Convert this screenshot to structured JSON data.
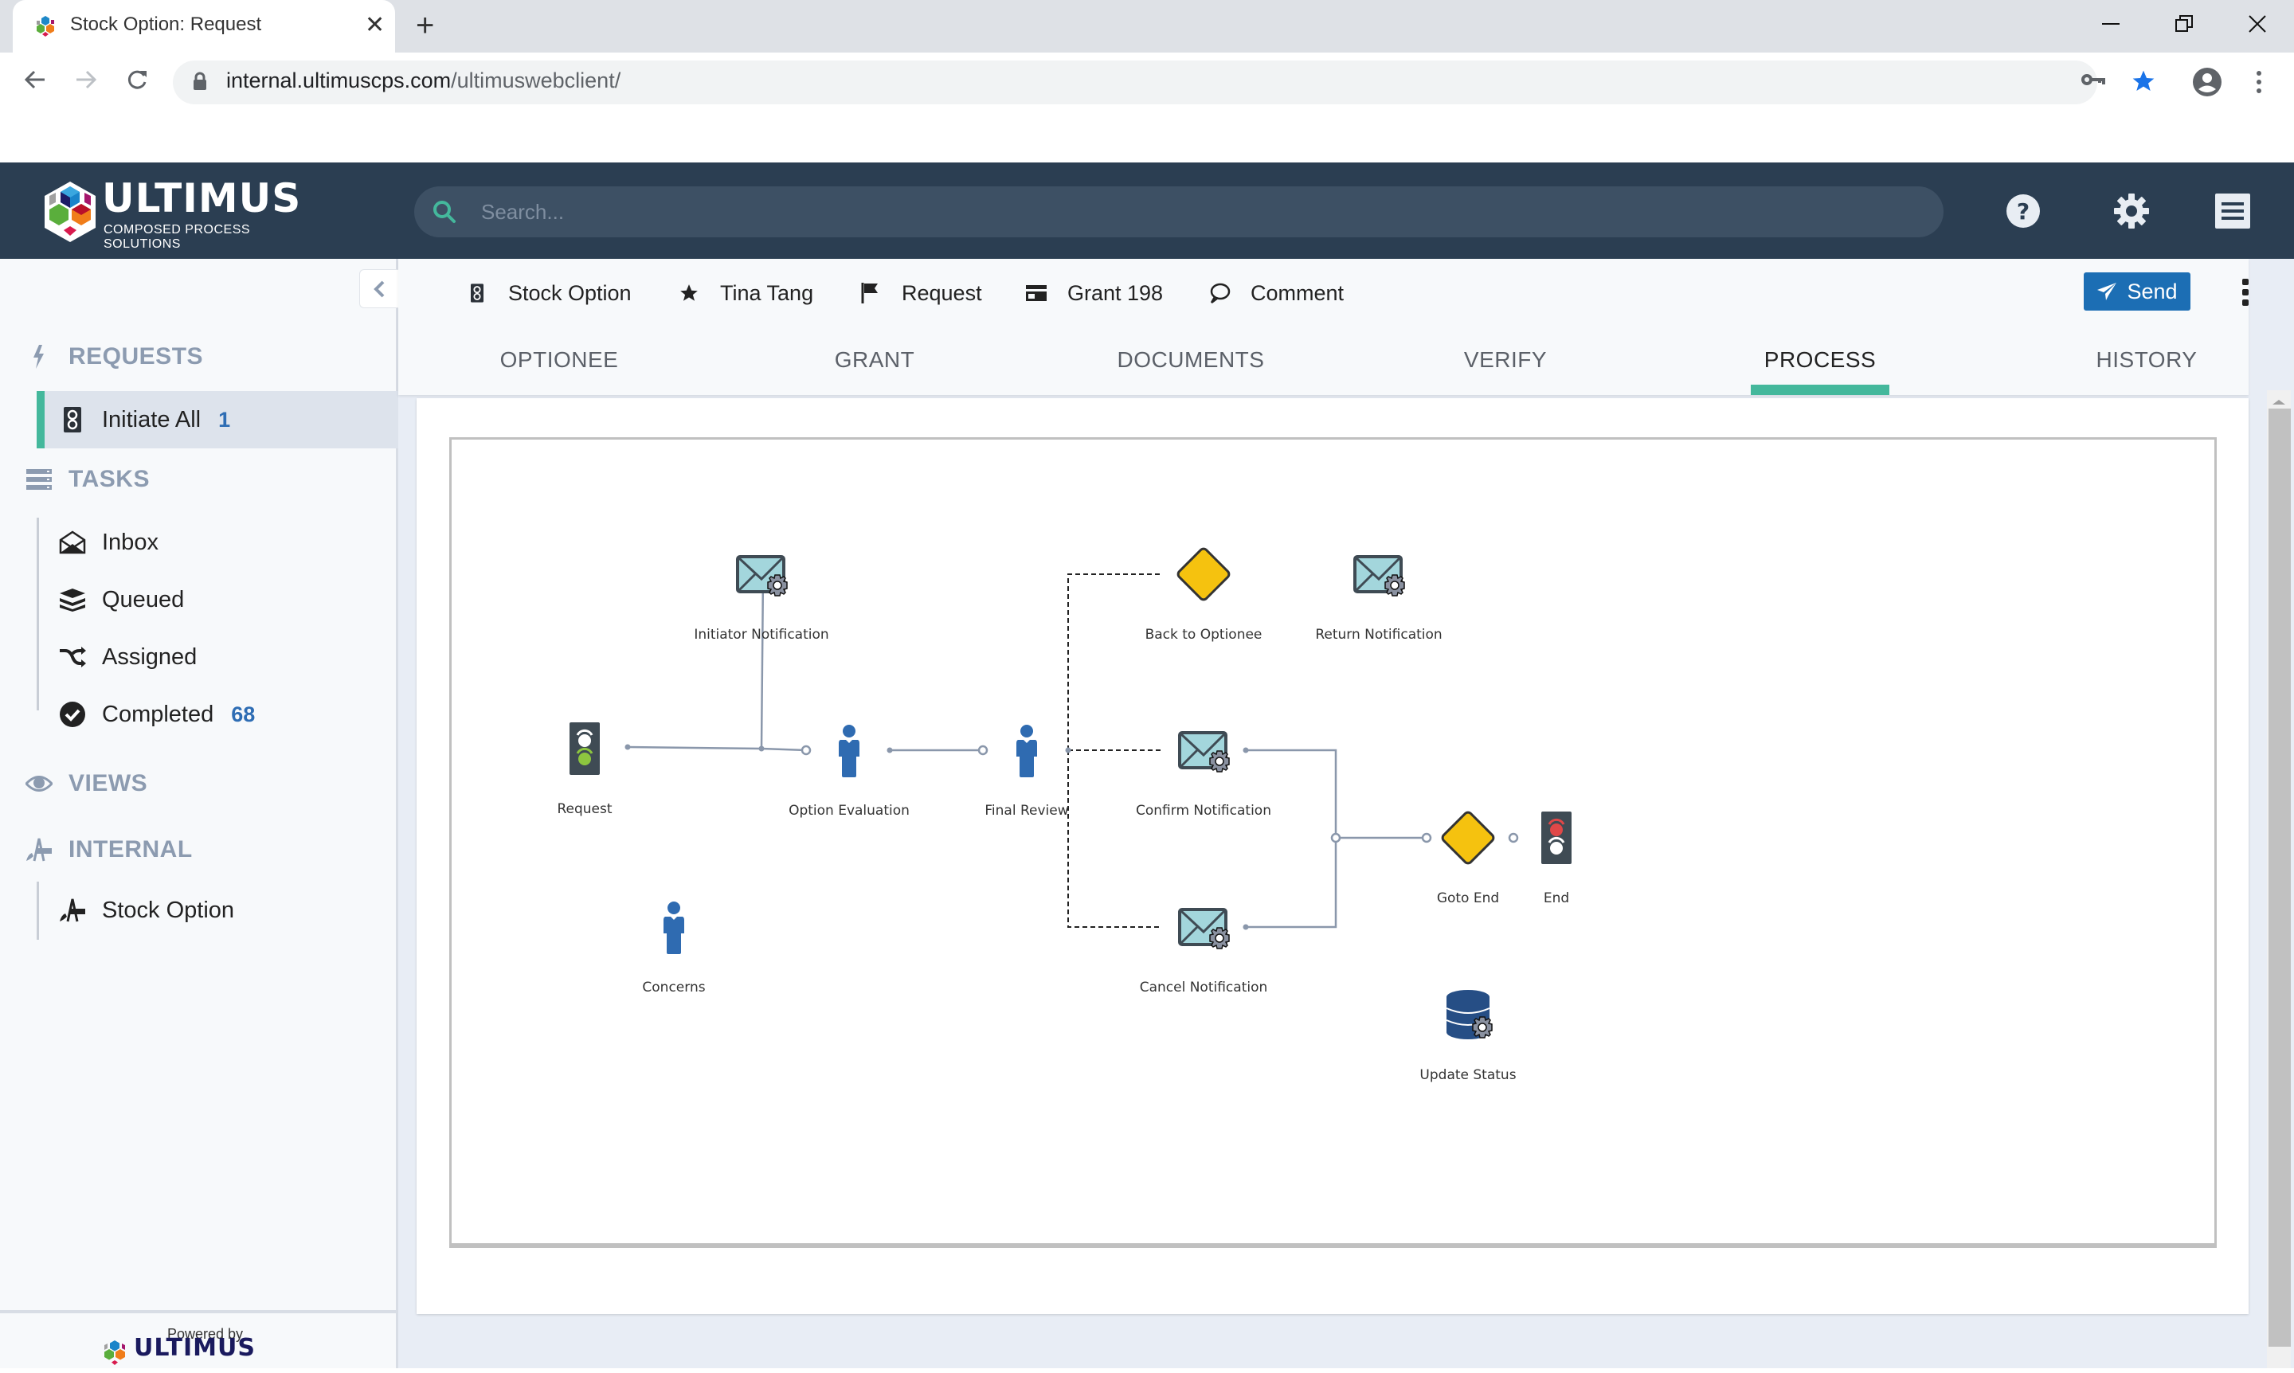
{
  "browser": {
    "tab_title": "Stock Option: Request",
    "url_host": "internal.ultimuscps.com",
    "url_path": "/ultimuswebclient/"
  },
  "header": {
    "logo_word": "ULTIMUS",
    "logo_sub": "COMPOSED PROCESS SOLUTIONS",
    "search_placeholder": "Search..."
  },
  "sidebar": {
    "sections": [
      {
        "label": "REQUESTS",
        "icon": "bolt-icon"
      },
      {
        "label": "TASKS",
        "icon": "tasks-icon"
      },
      {
        "label": "VIEWS",
        "icon": "eye-icon"
      },
      {
        "label": "INTERNAL",
        "icon": "drafting-icon"
      }
    ],
    "requests_items": [
      {
        "label": "Initiate All",
        "count": "1",
        "icon": "traffic-light-icon",
        "active": true
      }
    ],
    "tasks_items": [
      {
        "label": "Inbox",
        "count": "",
        "icon": "inbox-icon"
      },
      {
        "label": "Queued",
        "count": "",
        "icon": "layers-icon"
      },
      {
        "label": "Assigned",
        "count": "",
        "icon": "shuffle-icon"
      },
      {
        "label": "Completed",
        "count": "68",
        "icon": "check-circle-icon"
      }
    ],
    "internal_items": [
      {
        "label": "Stock Option",
        "icon": "drafting-icon"
      }
    ],
    "powered_by": "Powered by",
    "powered_logo": "ULTIMUS"
  },
  "toolbar": {
    "crumbs": [
      {
        "label": "Stock Option",
        "icon": "traffic-light-icon"
      },
      {
        "label": "Tina Tang",
        "icon": "star-icon"
      },
      {
        "label": "Request",
        "icon": "flag-icon"
      },
      {
        "label": "Grant 198",
        "icon": "card-icon"
      },
      {
        "label": "Comment",
        "icon": "comment-icon"
      }
    ],
    "send_label": "Send"
  },
  "tabs": [
    {
      "label": "OPTIONEE",
      "active": false
    },
    {
      "label": "GRANT",
      "active": false
    },
    {
      "label": "DOCUMENTS",
      "active": false
    },
    {
      "label": "VERIFY",
      "active": false
    },
    {
      "label": "PROCESS",
      "active": true
    },
    {
      "label": "HISTORY",
      "active": false
    }
  ],
  "diagram": {
    "nodes": [
      {
        "id": "request",
        "label": "Request",
        "type": "start"
      },
      {
        "id": "initiator",
        "label": "Initiator Notification",
        "type": "email"
      },
      {
        "id": "option_eval",
        "label": "Option Evaluation",
        "type": "user"
      },
      {
        "id": "final_review",
        "label": "Final Review",
        "type": "user"
      },
      {
        "id": "back_optionee",
        "label": "Back to Optionee",
        "type": "gateway"
      },
      {
        "id": "return_notif",
        "label": "Return Notification",
        "type": "email"
      },
      {
        "id": "confirm_notif",
        "label": "Confirm Notification",
        "type": "email"
      },
      {
        "id": "cancel_notif",
        "label": "Cancel Notification",
        "type": "email"
      },
      {
        "id": "goto_end",
        "label": "Goto End",
        "type": "gateway"
      },
      {
        "id": "end",
        "label": "End",
        "type": "end"
      },
      {
        "id": "concerns",
        "label": "Concerns",
        "type": "user"
      },
      {
        "id": "update_status",
        "label": "Update Status",
        "type": "database"
      }
    ],
    "links": [
      {
        "from": "request",
        "to": "option_eval",
        "style": "solid"
      },
      {
        "from": "request",
        "to": "initiator",
        "style": "solid"
      },
      {
        "from": "option_eval",
        "to": "final_review",
        "style": "solid"
      },
      {
        "from": "final_review",
        "to": "back_optionee",
        "style": "dashed"
      },
      {
        "from": "final_review",
        "to": "confirm_notif",
        "style": "dashed"
      },
      {
        "from": "final_review",
        "to": "cancel_notif",
        "style": "dashed"
      },
      {
        "from": "confirm_notif",
        "to": "goto_end",
        "style": "solid"
      },
      {
        "from": "cancel_notif",
        "to": "goto_end",
        "style": "solid"
      },
      {
        "from": "goto_end",
        "to": "end",
        "style": "solid"
      }
    ]
  },
  "colors": {
    "header_bg": "#2b3e52",
    "accent_teal": "#44b89c",
    "send_blue": "#1c6eb4",
    "count_blue": "#2e6db4",
    "gateway_yellow": "#f5c20f",
    "user_blue": "#2f6bb1",
    "email_fill": "#a3d6dc",
    "db_blue": "#264e85"
  }
}
